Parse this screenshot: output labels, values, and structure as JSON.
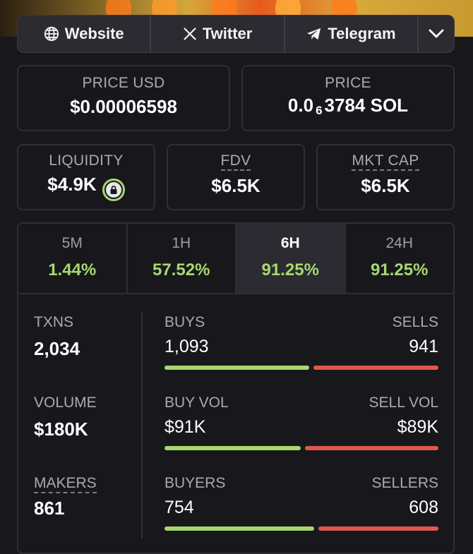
{
  "links": {
    "website": "Website",
    "twitter": "Twitter",
    "telegram": "Telegram"
  },
  "price_usd": {
    "label": "PRICE USD",
    "value": "$0.00006598"
  },
  "price_sol": {
    "label": "PRICE",
    "prefix": "0.0",
    "sub": "6",
    "rest": "3784 SOL"
  },
  "liquidity": {
    "label": "LIQUIDITY",
    "value": "$4.9K"
  },
  "fdv": {
    "label": "FDV",
    "value": "$6.5K"
  },
  "mkt_cap": {
    "label": "MKT CAP",
    "value": "$6.5K"
  },
  "tabs": [
    {
      "label": "5M",
      "value": "1.44%"
    },
    {
      "label": "1H",
      "value": "57.52%"
    },
    {
      "label": "6H",
      "value": "91.25%"
    },
    {
      "label": "24H",
      "value": "91.25%"
    }
  ],
  "stats": {
    "txns": {
      "label": "TXNS",
      "value": "2,034"
    },
    "volume": {
      "label": "VOLUME",
      "value": "$180K"
    },
    "makers": {
      "label": "MAKERS",
      "value": "861"
    }
  },
  "splits": {
    "txns": {
      "left_label": "BUYS",
      "right_label": "SELLS",
      "left_value": "1,093",
      "right_value": "941",
      "buy_fraction": 0.537
    },
    "volume": {
      "left_label": "BUY VOL",
      "right_label": "SELL VOL",
      "left_value": "$91K",
      "right_value": "$89K",
      "buy_fraction": 0.506
    },
    "makers": {
      "left_label": "BUYERS",
      "right_label": "SELLERS",
      "left_value": "754",
      "right_value": "608",
      "buy_fraction": 0.554
    }
  },
  "colors": {
    "green": "#a6d86f",
    "red": "#e0574f",
    "bg": "#18181c"
  }
}
